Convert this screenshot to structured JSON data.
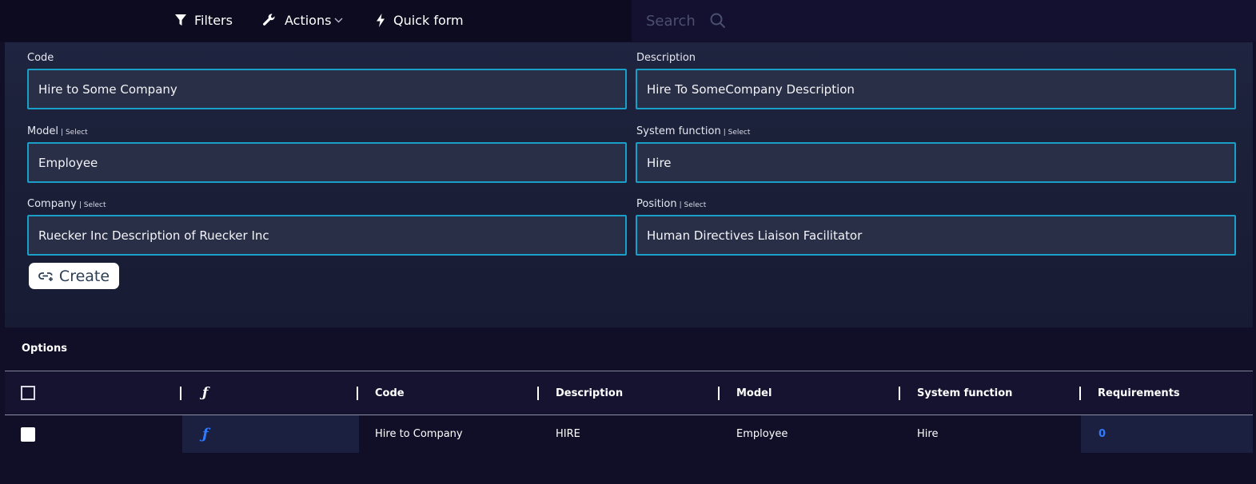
{
  "toolbar": {
    "filters_label": "Filters",
    "actions_label": "Actions",
    "quick_form_label": "Quick form",
    "search_placeholder": "Search"
  },
  "form": {
    "select_hint": "| Select",
    "code": {
      "label": "Code",
      "value": "Hire to Some Company"
    },
    "description": {
      "label": "Description",
      "value": "Hire To SomeCompany Description"
    },
    "model": {
      "label": "Model",
      "value": "Employee"
    },
    "system_function": {
      "label": "System function",
      "value": "Hire"
    },
    "company": {
      "label": "Company",
      "value": "Ruecker Inc Description of Ruecker Inc"
    },
    "position": {
      "label": "Position",
      "value": "Human Directives Liaison Facilitator"
    },
    "create_label": "Create"
  },
  "options": {
    "title": "Options",
    "columns": [
      "ƒ",
      "Code",
      "Description",
      "Model",
      "System function",
      "Requirements"
    ],
    "rows": [
      {
        "fx": "ƒ",
        "code": "Hire to Company",
        "description": "HIRE",
        "model": "Employee",
        "system_function": "Hire",
        "requirements": "0"
      }
    ]
  },
  "colors": {
    "accent_border": "#1aa0c8",
    "link": "#2f7bff",
    "background": "#110e27"
  }
}
